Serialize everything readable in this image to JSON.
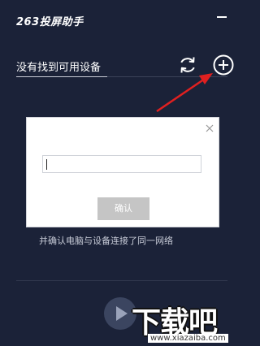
{
  "app": {
    "title": "263投屏助手"
  },
  "device_panel": {
    "status_text": "没有找到可用设备",
    "refresh_icon": "refresh-icon",
    "add_icon": "plus-circle-icon"
  },
  "dialog": {
    "input_value": "",
    "confirm_label": "确认",
    "close_icon": "close-icon"
  },
  "hint": {
    "text": "并确认电脑与设备连接了同一网络"
  },
  "footer": {
    "play_icon": "play-icon"
  },
  "watermark": {
    "text": "下载吧",
    "url": "www.xiazaiba.com"
  },
  "colors": {
    "background": "#1b2238",
    "annotation_arrow": "#e02020",
    "confirm_button": "#c5c5c5"
  }
}
